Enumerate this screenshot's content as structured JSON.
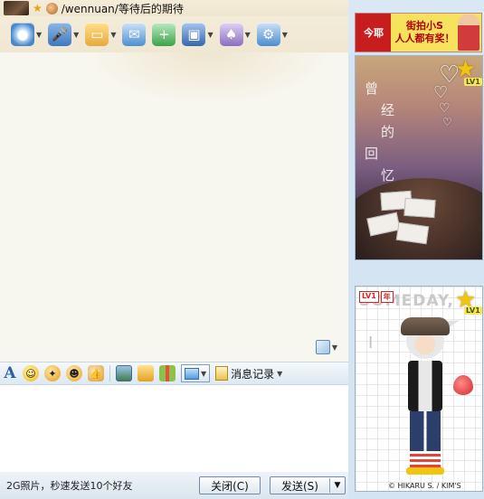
{
  "window": {
    "contact_title": "/wennuan/等待后的期待"
  },
  "toolbar": {
    "buttons": [
      {
        "name": "video-call",
        "icon": "webcam-icon",
        "color": "#4a86c8"
      },
      {
        "name": "voice-call",
        "icon": "microphone-icon",
        "color": "#3f78c0"
      },
      {
        "name": "send-file",
        "icon": "folder-icon",
        "color": "#e7a93c"
      },
      {
        "name": "send-sms",
        "icon": "message-icon",
        "color": "#4c8fd0"
      },
      {
        "name": "create-group",
        "icon": "add-group-icon",
        "color": "#3aa34a"
      },
      {
        "name": "remote-assist",
        "icon": "remote-icon",
        "color": "#3566b0"
      },
      {
        "name": "apps",
        "icon": "apps-icon",
        "color": "#8a6fc0"
      },
      {
        "name": "settings",
        "icon": "settings-icon",
        "color": "#4d8bd0"
      }
    ]
  },
  "ad": {
    "logo": "今耶",
    "line1": "街拍小S",
    "line2": "人人都有奖！"
  },
  "qqshow_top": {
    "poem": [
      "曾",
      "经",
      "的",
      "回",
      "忆"
    ],
    "level": "LV1"
  },
  "qqshow_bottom": {
    "tag1": "LV1",
    "tag2": "年",
    "level": "LV1",
    "text_someday": "SOMEDAY,",
    "text_idly": "I",
    "copyright": "© HIKARU S. / KIM'S"
  },
  "format_bar": {
    "history_label": "消息记录"
  },
  "bottom": {
    "tip": "2G照片，秒速发送10个好友",
    "close_label": "关闭(C)",
    "send_label": "发送(S)"
  }
}
